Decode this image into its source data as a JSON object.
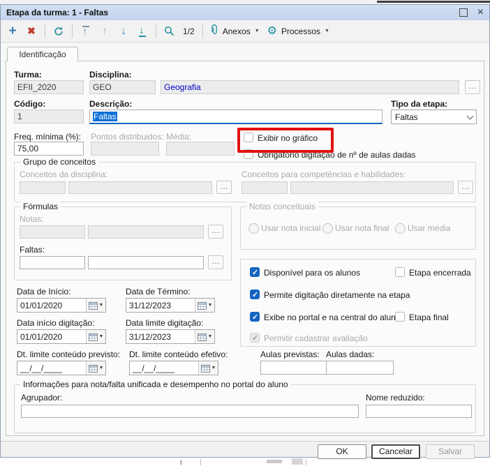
{
  "window": {
    "title": "Etapa da turma: 1 - Faltas"
  },
  "icons": {
    "add": "+",
    "delete": "✖",
    "up": "↑",
    "down": "↓",
    "caret": "▼",
    "ellipsis": "…",
    "gear": "⚙",
    "close": "×"
  },
  "toolbar": {
    "pager": "1/2",
    "anexos": "Anexos",
    "processos": "Processos"
  },
  "tabs": {
    "identificacao": "Identificação"
  },
  "fields": {
    "turma": {
      "label": "Turma:",
      "value": "EFII_2020"
    },
    "disciplina": {
      "label": "Disciplina:",
      "code": "GEO",
      "name": "Geografia"
    },
    "codigo": {
      "label": "Código:",
      "value": "1"
    },
    "descricao": {
      "label": "Descrição:",
      "value": "Faltas"
    },
    "tipo_etapa": {
      "label": "Tipo da etapa:",
      "value": "Faltas"
    },
    "freq_minima": {
      "label": "Freq. mínima (%):",
      "value": "75,00"
    },
    "pontos": {
      "label": "Pontos distribuidos:",
      "value": ""
    },
    "media": {
      "label": "Média:",
      "value": ""
    }
  },
  "flags": {
    "exibir_grafico": {
      "label": "Exibir no gráfico",
      "checked": false
    },
    "obrigatorio_aulas": {
      "label": "Obrigatório digitação de nº de aulas dadas",
      "checked": false
    }
  },
  "grupo_conceitos": {
    "title": "Grupo de conceitos",
    "disciplina_label": "Conceitos da disciplina:",
    "competencias_label": "Conceitos para competências e habilidades:"
  },
  "formulas": {
    "title": "Fórmulas",
    "notas_label": "Notas:",
    "faltas_label": "Faltas:"
  },
  "notas_conceituais": {
    "title": "Notas conceituais",
    "options": [
      {
        "label": "Usar nota inicial",
        "selected": false
      },
      {
        "label": "Usar nota final",
        "selected": false
      },
      {
        "label": "Usar média",
        "selected": false
      }
    ]
  },
  "opcoes": {
    "disponivel": {
      "label": "Disponível para os alunos",
      "checked": true
    },
    "encerrada": {
      "label": "Etapa encerrada",
      "checked": false
    },
    "permite_digitacao": {
      "label": "Permite digitação diretamente na etapa",
      "checked": true
    },
    "exibe_portal": {
      "label": "Exibe no portal e na central do aluno",
      "checked": true
    },
    "etapa_final": {
      "label": "Etapa final",
      "checked": false
    },
    "permitir_avaliacao": {
      "label": "Permitir cadastrar avaliação",
      "checked": true,
      "disabled": true
    }
  },
  "datas": {
    "inicio": {
      "label": "Data de Início:",
      "value": "01/01/2020"
    },
    "termino": {
      "label": "Data de Término:",
      "value": "31/12/2023"
    },
    "inicio_digitacao": {
      "label": "Data início digitação:",
      "value": "01/01/2020"
    },
    "limite_digitacao": {
      "label": "Data limite digitação:",
      "value": "31/12/2023"
    },
    "limite_conteudo_previsto": {
      "label": "Dt. limite conteúdo previsto:",
      "value": "__/__/____"
    },
    "limite_conteudo_efetivo": {
      "label": "Dt. limite conteúdo efetivo:",
      "value": "__/__/____"
    }
  },
  "aulas": {
    "previstas": {
      "label": "Aulas previstas:",
      "value": ""
    },
    "dadas": {
      "label": "Aulas dadas:",
      "value": ""
    }
  },
  "info_unificada": {
    "title": "Informações para nota/falta unificada e desempenho no portal do aluno",
    "agrupador_label": "Agrupador:",
    "nome_reduzido_label": "Nome reduzido:"
  },
  "footer": {
    "ok": "OK",
    "cancelar": "Cancelar",
    "salvar": "Salvar"
  },
  "colors": {
    "titlebar": "#CBDAF1",
    "selection": "#0A6ED6",
    "checkbox_blue": "#1565C0",
    "highlight_red": "#E21010",
    "icon_teal": "#1E8C9C",
    "link_blue": "#0000CC"
  }
}
